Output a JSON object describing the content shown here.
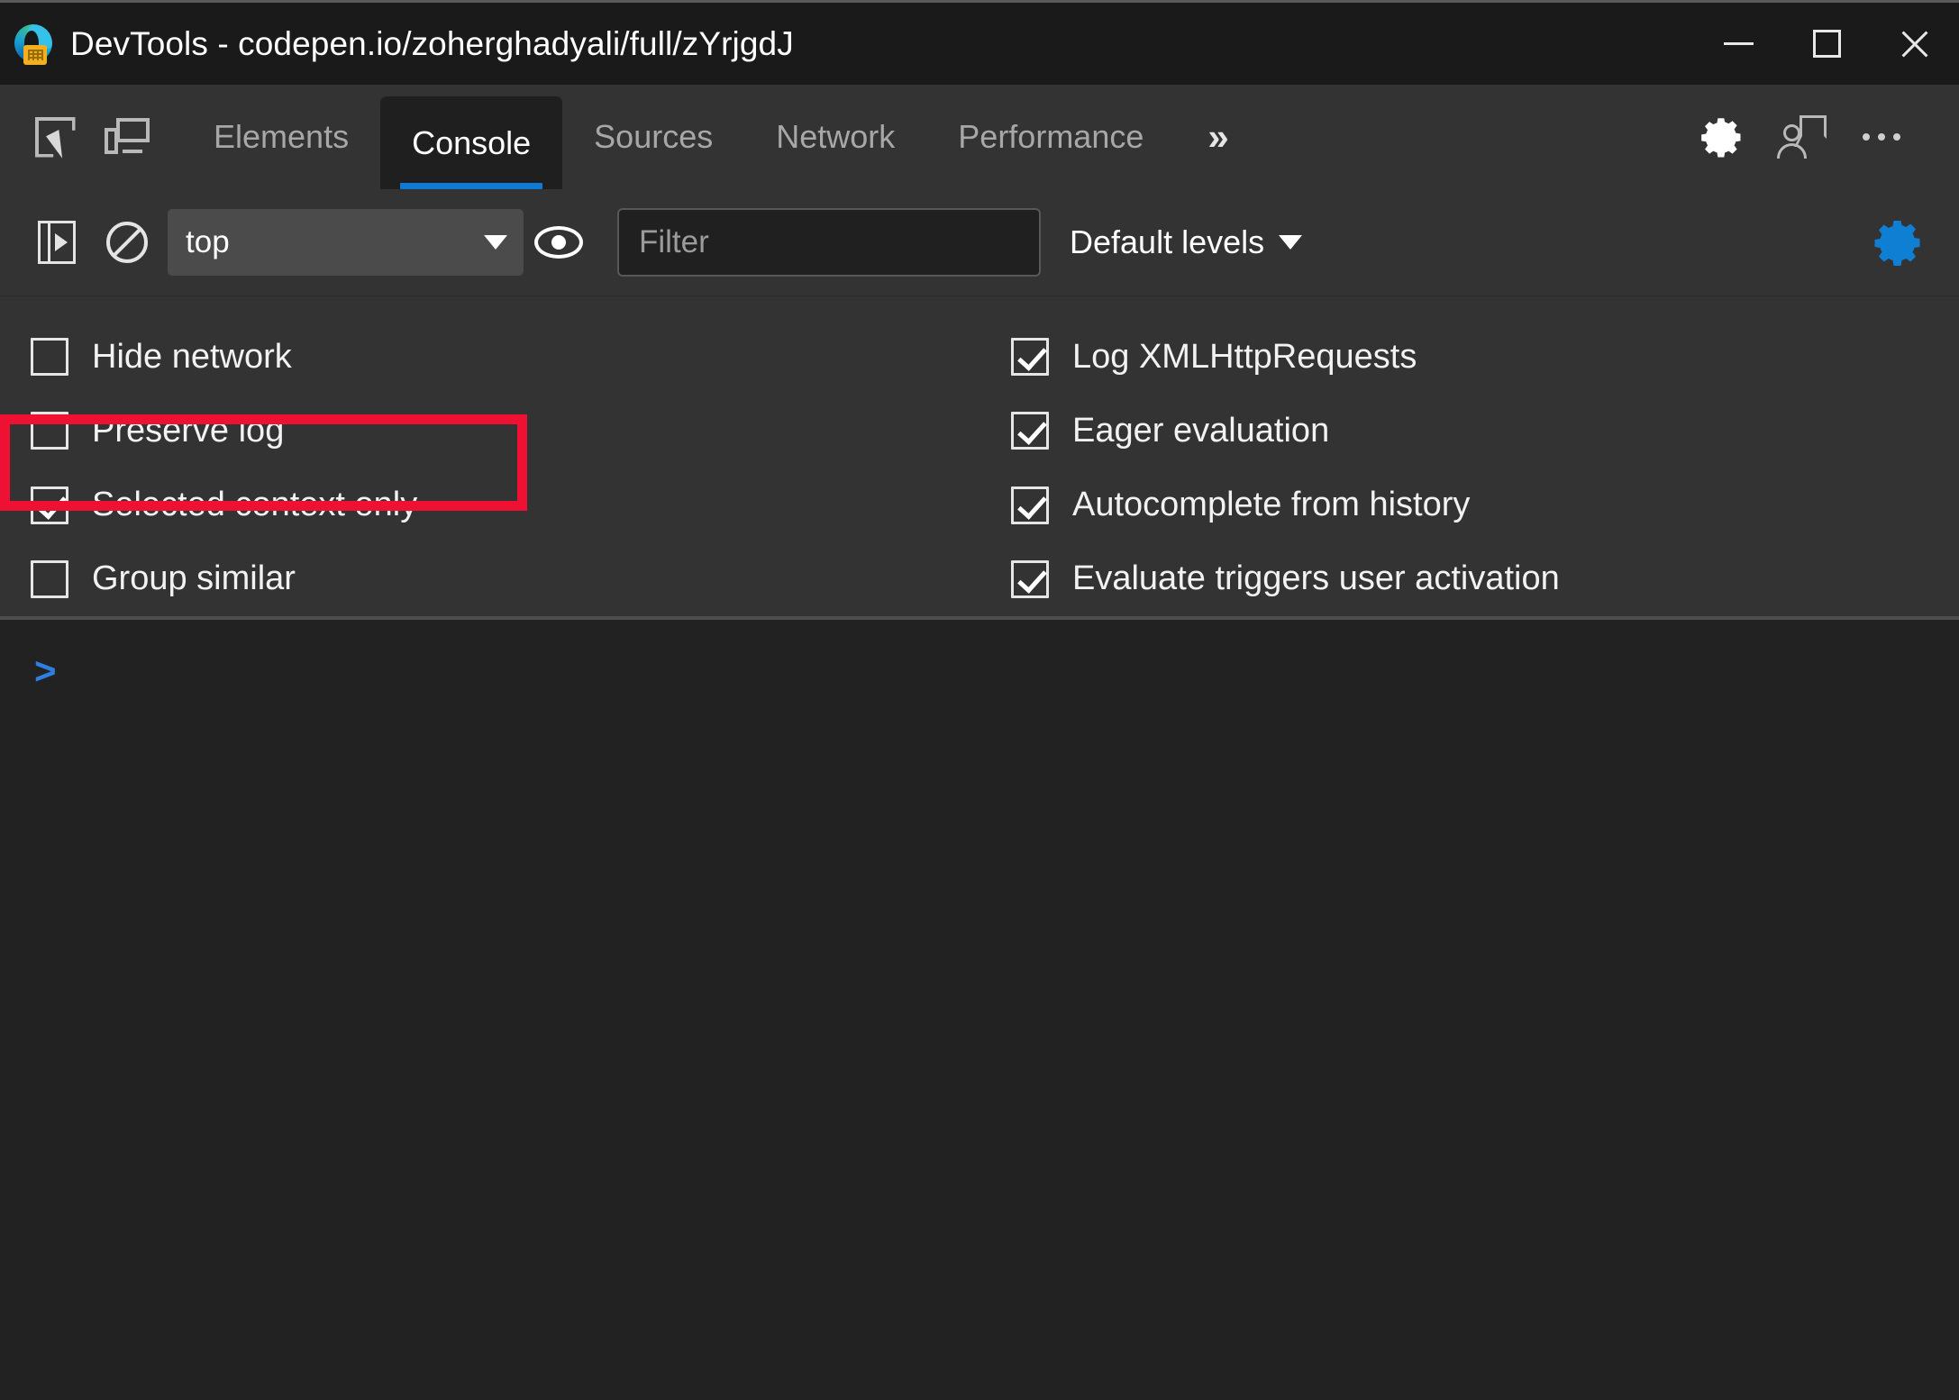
{
  "window": {
    "title": "DevTools - codepen.io/zoherghadyali/full/zYrjgdJ",
    "app_icon": "edge-devtools-icon",
    "controls": {
      "minimize": "minimize-icon",
      "maximize": "maximize-icon",
      "close": "close-icon"
    }
  },
  "tabbar": {
    "inspect_icon": "inspect-element-icon",
    "device_icon": "device-toolbar-icon",
    "tabs": [
      {
        "label": "Elements",
        "active": false
      },
      {
        "label": "Console",
        "active": true
      },
      {
        "label": "Sources",
        "active": false
      },
      {
        "label": "Network",
        "active": false
      },
      {
        "label": "Performance",
        "active": false
      }
    ],
    "overflow_label": "»",
    "settings_icon": "gear-icon",
    "feedback_icon": "feedback-person-icon",
    "more_icon": "more-options-icon"
  },
  "console_toolbar": {
    "sidebar_toggle_icon": "sidebar-toggle-icon",
    "clear_console_icon": "clear-console-icon",
    "context": {
      "value": "top",
      "caret": "chevron-down-icon"
    },
    "eye_icon": "live-expression-eye-icon",
    "filter": {
      "value": "",
      "placeholder": "Filter"
    },
    "levels": {
      "label": "Default levels",
      "caret": "chevron-down-icon"
    },
    "settings_gear_icon": "console-settings-gear-icon",
    "settings_gear_color": "#0f7fd4"
  },
  "settings_panel": {
    "left_column": [
      {
        "label": "Hide network",
        "checked": false
      },
      {
        "label": "Preserve log",
        "checked": false
      },
      {
        "label": "Selected context only",
        "checked": true
      },
      {
        "label": "Group similar",
        "checked": false
      }
    ],
    "right_column": [
      {
        "label": "Log XMLHttpRequests",
        "checked": true
      },
      {
        "label": "Eager evaluation",
        "checked": true
      },
      {
        "label": "Autocomplete from history",
        "checked": true
      },
      {
        "label": "Evaluate triggers user activation",
        "checked": true
      }
    ],
    "highlight": {
      "target_label": "Selected context only",
      "color": "#ee1133"
    }
  },
  "console_body": {
    "prompt": ">",
    "prompt_color": "#2f7fe0",
    "entries": []
  },
  "colors": {
    "titlebar_bg": "#1a1a1a",
    "toolbar_bg": "#333333",
    "console_bg": "#222222",
    "active_tab_bg": "#1f1f1f",
    "accent_blue": "#0e7ad4",
    "highlight_red": "#ee1133"
  }
}
